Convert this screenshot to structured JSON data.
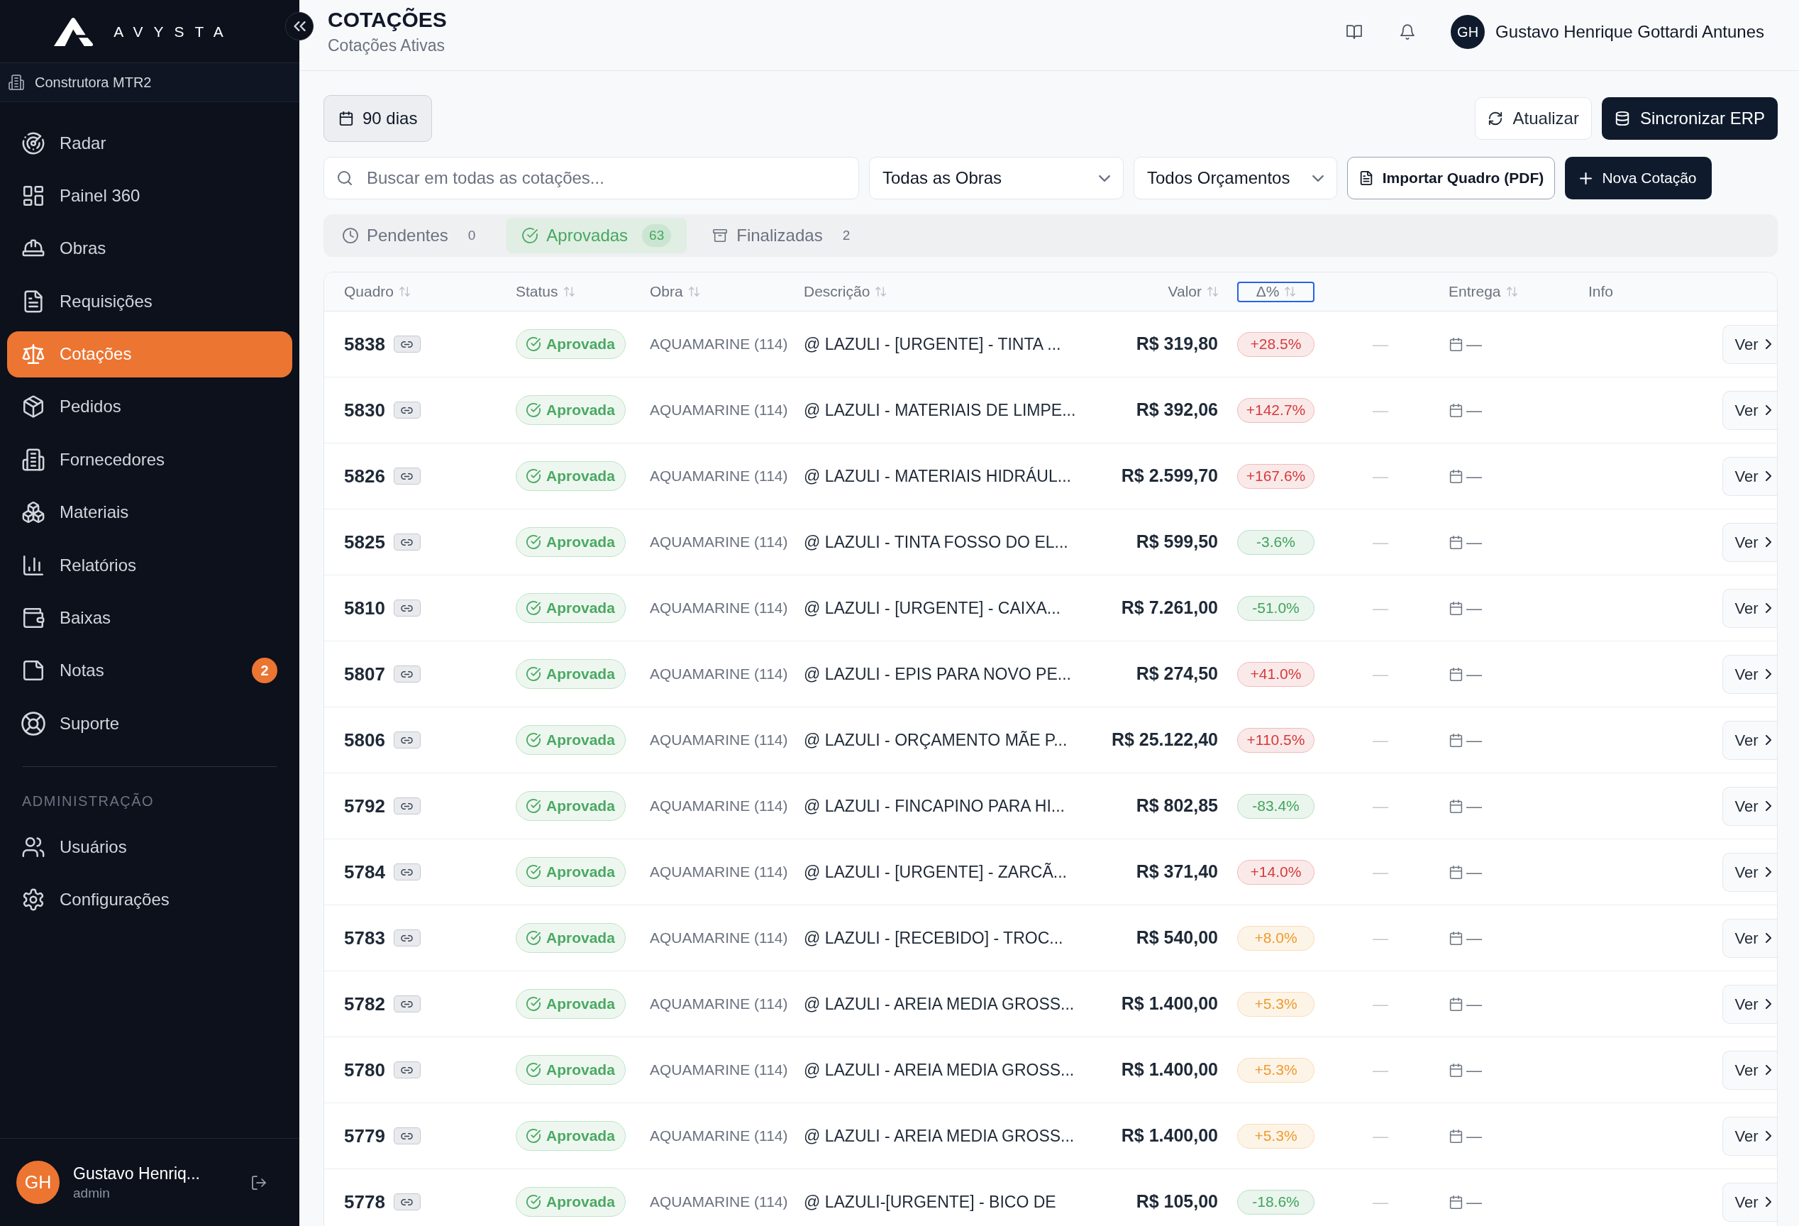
{
  "sidebar": {
    "logo": "AVYSTA",
    "company": "Construtora MTR2",
    "items": [
      {
        "label": "Radar",
        "selected": false
      },
      {
        "label": "Painel 360",
        "selected": false
      },
      {
        "label": "Obras",
        "selected": false
      },
      {
        "label": "Requisições",
        "selected": false
      },
      {
        "label": "Cotações",
        "selected": true
      },
      {
        "label": "Pedidos",
        "selected": false
      },
      {
        "label": "Fornecedores",
        "selected": false
      },
      {
        "label": "Materiais",
        "selected": false
      },
      {
        "label": "Relatórios",
        "selected": false
      },
      {
        "label": "Baixas",
        "selected": false
      },
      {
        "label": "Notas",
        "selected": false,
        "badge": "2"
      },
      {
        "label": "Suporte",
        "selected": false
      }
    ],
    "section_label": "ADMINISTRAÇÃO",
    "admin_items": [
      {
        "label": "Usuários",
        "selected": false
      },
      {
        "label": "Configurações",
        "selected": false
      }
    ],
    "user": {
      "initials": "GH",
      "name": "Gustavo Henriq...",
      "role": "admin"
    }
  },
  "header": {
    "title": "COTAÇÕES",
    "subtitle": "Cotações Ativas",
    "user": {
      "initials": "GH",
      "name": "Gustavo Henrique Gottardi Antunes"
    }
  },
  "toolbar": {
    "period": "90 dias",
    "refresh": "Atualizar",
    "sync": "Sincronizar ERP",
    "search": {
      "placeholder": "Buscar em todas as cotações..."
    },
    "filters": [
      {
        "value": "Todas as Obras"
      },
      {
        "value": "Todos Orçamentos"
      }
    ],
    "import": "Importar Quadro (PDF)",
    "new": "Nova Cotação"
  },
  "tabs": [
    {
      "label": "Pendentes",
      "count": "0",
      "selected": false
    },
    {
      "label": "Aprovadas",
      "count": "63",
      "selected": true
    },
    {
      "label": "Finalizadas",
      "count": "2",
      "selected": false
    }
  ],
  "table": {
    "columns": [
      {
        "label": "Quadro",
        "sortable": true,
        "focused": false
      },
      {
        "label": "Status",
        "sortable": true,
        "focused": false
      },
      {
        "label": "Obra",
        "sortable": true,
        "focused": false
      },
      {
        "label": "Descrição",
        "sortable": true,
        "focused": false
      },
      {
        "label": "Valor",
        "sortable": true,
        "focused": false
      },
      {
        "label": "Δ%",
        "sortable": true,
        "focused": true
      },
      {
        "label": "Entrega",
        "sortable": true,
        "focused": false
      },
      {
        "label": "Info",
        "sortable": false,
        "focused": false
      }
    ],
    "rows": [
      {
        "quadro": "5838",
        "status": "Aprovada",
        "obra": "AQUAMARINE (114)",
        "descricao": "@ LAZULI - [URGENTE] - TINTA ...",
        "valor": "R$ 319,80",
        "delta": {
          "text": "+28.5%",
          "color": "#d63a3a"
        },
        "column_7": "—",
        "entrega": "—",
        "action": "Ver"
      },
      {
        "quadro": "5830",
        "status": "Aprovada",
        "obra": "AQUAMARINE (114)",
        "descricao": "@ LAZULI - MATERIAIS DE LIMPE...",
        "valor": "R$ 392,06",
        "delta": {
          "text": "+142.7%",
          "color": "#d63a3a"
        },
        "column_7": "—",
        "entrega": "—",
        "action": "Ver"
      },
      {
        "quadro": "5826",
        "status": "Aprovada",
        "obra": "AQUAMARINE (114)",
        "descricao": "@ LAZULI - MATERIAIS HIDRÁUL...",
        "valor": "R$ 2.599,70",
        "delta": {
          "text": "+167.6%",
          "color": "#d63a3a"
        },
        "column_7": "—",
        "entrega": "—",
        "action": "Ver"
      },
      {
        "quadro": "5825",
        "status": "Aprovada",
        "obra": "AQUAMARINE (114)",
        "descricao": "@ LAZULI - TINTA FOSSO DO EL...",
        "valor": "R$ 599,50",
        "delta": {
          "text": "-3.6%",
          "color": "#3fa45b"
        },
        "column_7": "—",
        "entrega": "—",
        "action": "Ver"
      },
      {
        "quadro": "5810",
        "status": "Aprovada",
        "obra": "AQUAMARINE (114)",
        "descricao": "@ LAZULI - [URGENTE] - CAIXA...",
        "valor": "R$ 7.261,00",
        "delta": {
          "text": "-51.0%",
          "color": "#3fa45b"
        },
        "column_7": "—",
        "entrega": "—",
        "action": "Ver"
      },
      {
        "quadro": "5807",
        "status": "Aprovada",
        "obra": "AQUAMARINE (114)",
        "descricao": "@ LAZULI - EPIS PARA NOVO PE...",
        "valor": "R$ 274,50",
        "delta": {
          "text": "+41.0%",
          "color": "#d63a3a"
        },
        "column_7": "—",
        "entrega": "—",
        "action": "Ver"
      },
      {
        "quadro": "5806",
        "status": "Aprovada",
        "obra": "AQUAMARINE (114)",
        "descricao": "@ LAZULI - ORÇAMENTO MÃE P...",
        "valor": "R$ 25.122,40",
        "delta": {
          "text": "+110.5%",
          "color": "#d63a3a"
        },
        "column_7": "—",
        "entrega": "—",
        "action": "Ver"
      },
      {
        "quadro": "5792",
        "status": "Aprovada",
        "obra": "AQUAMARINE (114)",
        "descricao": "@ LAZULI - FINCAPINO PARA HI...",
        "valor": "R$ 802,85",
        "delta": {
          "text": "-83.4%",
          "color": "#3fa45b"
        },
        "column_7": "—",
        "entrega": "—",
        "action": "Ver"
      },
      {
        "quadro": "5784",
        "status": "Aprovada",
        "obra": "AQUAMARINE (114)",
        "descricao": "@ LAZULI - [URGENTE] - ZARCÃ...",
        "valor": "R$ 371,40",
        "delta": {
          "text": "+14.0%",
          "color": "#d63a3a"
        },
        "column_7": "—",
        "entrega": "—",
        "action": "Ver"
      },
      {
        "quadro": "5783",
        "status": "Aprovada",
        "obra": "AQUAMARINE (114)",
        "descricao": "@ LAZULI - [RECEBIDO] - TROC...",
        "valor": "R$ 540,00",
        "delta": {
          "text": "+8.0%",
          "color": "#ef9a2c"
        },
        "column_7": "—",
        "entrega": "—",
        "action": "Ver"
      },
      {
        "quadro": "5782",
        "status": "Aprovada",
        "obra": "AQUAMARINE (114)",
        "descricao": "@ LAZULI - AREIA MEDIA GROSS...",
        "valor": "R$ 1.400,00",
        "delta": {
          "text": "+5.3%",
          "color": "#ef9a2c"
        },
        "column_7": "—",
        "entrega": "—",
        "action": "Ver"
      },
      {
        "quadro": "5780",
        "status": "Aprovada",
        "obra": "AQUAMARINE (114)",
        "descricao": "@ LAZULI - AREIA MEDIA GROSS...",
        "valor": "R$ 1.400,00",
        "delta": {
          "text": "+5.3%",
          "color": "#ef9a2c"
        },
        "column_7": "—",
        "entrega": "—",
        "action": "Ver"
      },
      {
        "quadro": "5779",
        "status": "Aprovada",
        "obra": "AQUAMARINE (114)",
        "descricao": "@ LAZULI - AREIA MEDIA GROSS...",
        "valor": "R$ 1.400,00",
        "delta": {
          "text": "+5.3%",
          "color": "#ef9a2c"
        },
        "column_7": "—",
        "entrega": "—",
        "action": "Ver"
      },
      {
        "quadro": "5778",
        "status": "Aprovada",
        "obra": "AQUAMARINE (114)",
        "descricao": "@ LAZULI-[URGENTE] - BICO DE",
        "valor": "R$ 105,00",
        "delta": {
          "text": "-18.6%",
          "color": "#3fa45b"
        },
        "column_7": "—",
        "entrega": "—",
        "action": "Ver"
      }
    ]
  }
}
